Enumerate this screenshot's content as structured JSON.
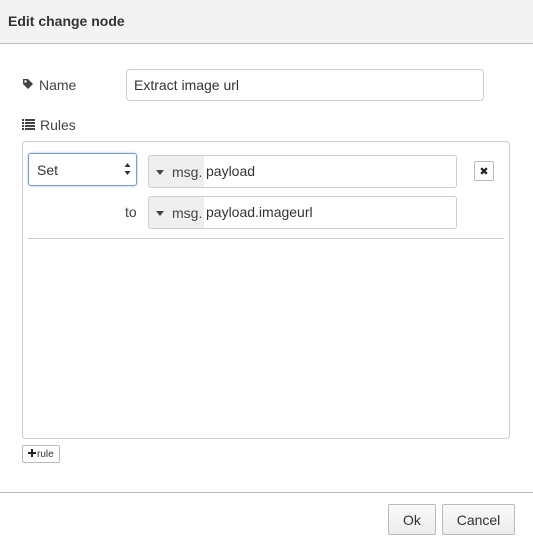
{
  "dialog": {
    "title": "Edit change node"
  },
  "name": {
    "label": "Name",
    "value": "Extract image url"
  },
  "rules": {
    "label": "Rules",
    "rule": {
      "action": "Set",
      "property_type": "msg.",
      "property_value": "payload",
      "to_label": "to",
      "to_type": "msg.",
      "to_value": "payload.imageurl"
    },
    "add_rule_label": "rule"
  },
  "buttons": {
    "ok": "Ok",
    "cancel": "Cancel"
  },
  "icons": {
    "name": "tag-icon",
    "rules": "list-icon",
    "remove": "close-icon",
    "add": "plus-icon"
  }
}
